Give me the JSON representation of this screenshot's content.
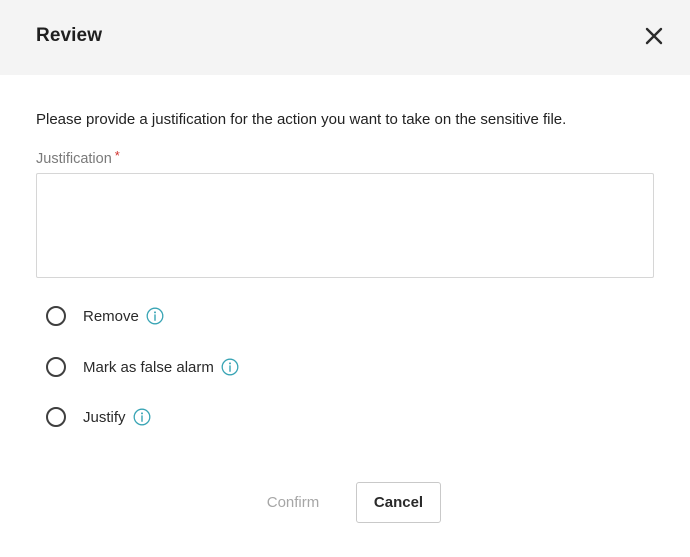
{
  "dialog": {
    "title": "Review",
    "instruction": "Please provide a justification for the action you want to take on the sensitive file.",
    "justification": {
      "label": "Justification",
      "required_marker": "*",
      "value": "",
      "placeholder": ""
    },
    "options": [
      {
        "label": "Remove",
        "selected": false,
        "icon": "info-icon"
      },
      {
        "label": "Mark as false alarm",
        "selected": false,
        "icon": "info-icon"
      },
      {
        "label": "Justify",
        "selected": false,
        "icon": "info-icon"
      }
    ],
    "buttons": {
      "confirm_label": "Confirm",
      "cancel_label": "Cancel"
    },
    "icons": {
      "close": "close-icon",
      "info": "info-icon"
    },
    "colors": {
      "header_bg": "#f4f4f4",
      "info_icon": "#3aa5b5",
      "required_star": "#d0312d",
      "confirm_disabled_text": "#a6a6a6"
    }
  }
}
